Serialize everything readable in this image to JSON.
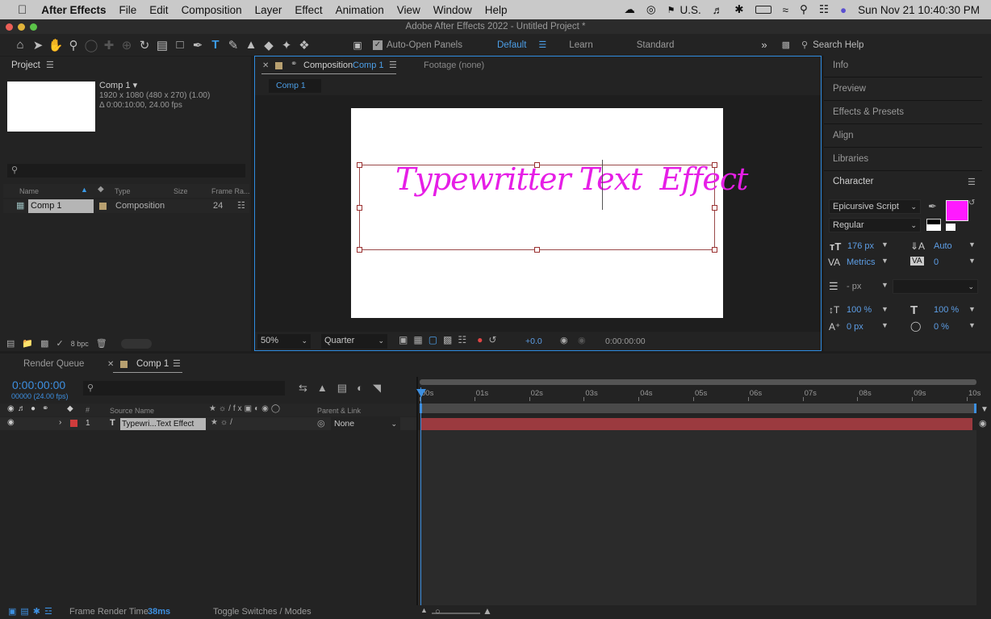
{
  "menubar": {
    "app": "After Effects",
    "items": [
      "File",
      "Edit",
      "Composition",
      "Layer",
      "Effect",
      "Animation",
      "View",
      "Window",
      "Help"
    ],
    "input_source": "U.S.",
    "clock": "Sun Nov 21  10:40:30 PM"
  },
  "window_title": "Adobe After Effects 2022 - Untitled Project *",
  "toolbar": {
    "auto_open_label": "Auto-Open Panels",
    "workspaces": [
      "Default",
      "Learn",
      "Standard"
    ],
    "search_placeholder": "Search Help"
  },
  "project": {
    "tab": "Project",
    "comp_name": "Comp 1 ▾",
    "comp_info_1": "1920 x 1080  (480 x 270) (1.00)",
    "comp_info_2": "Δ 0:00:10:00, 24.00 fps",
    "columns": [
      "Name",
      "Type",
      "Size",
      "Frame Ra..."
    ],
    "rows": [
      {
        "name": "Comp 1",
        "type": "Composition",
        "size": "",
        "fps": "24"
      }
    ],
    "bpc": "8 bpc"
  },
  "composition": {
    "tab_prefix": "Composition",
    "tab_name": "Comp 1",
    "footage_tab": "Footage (none)",
    "sub_tab": "Comp 1",
    "canvas_text": "Typewritter Text  Effect",
    "zoom": "50%",
    "quality": "Quarter",
    "exposure": "+0.0",
    "timecode": "0:00:00:00"
  },
  "right_panel": {
    "items": [
      "Info",
      "Preview",
      "Effects & Presets",
      "Align",
      "Libraries"
    ],
    "character_title": "Character",
    "font_family": "Epicursive Script",
    "font_style": "Regular",
    "font_size": "176 px",
    "leading": "Auto",
    "kerning": "Metrics",
    "tracking": "0",
    "line_spacing": "- px",
    "vscale": "100 %",
    "hscale": "100 %",
    "baseline": "0 px",
    "tsume": "0 %",
    "fill_color": "#ff1aff"
  },
  "timeline": {
    "render_queue_tab": "Render Queue",
    "comp_tab": "Comp 1",
    "timecode": "0:00:00:00",
    "timecode_sub": "00000 (24.00 fps)",
    "col_source": "Source Name",
    "col_parent": "Parent & Link",
    "layer_num": "1",
    "layer_name": "Typewri...Text Effect",
    "parent_value": "None",
    "ruler": [
      "00s",
      "01s",
      "02s",
      "03s",
      "04s",
      "05s",
      "06s",
      "07s",
      "08s",
      "09s",
      "10s"
    ],
    "frame_render_label": "Frame Render Time",
    "frame_render_value": "38ms",
    "toggle_label": "Toggle Switches / Modes"
  },
  "colors": {
    "accent": "#2f8ce0",
    "layer_bar": "#9b3a3f",
    "text_fill": "#e61ee6"
  }
}
